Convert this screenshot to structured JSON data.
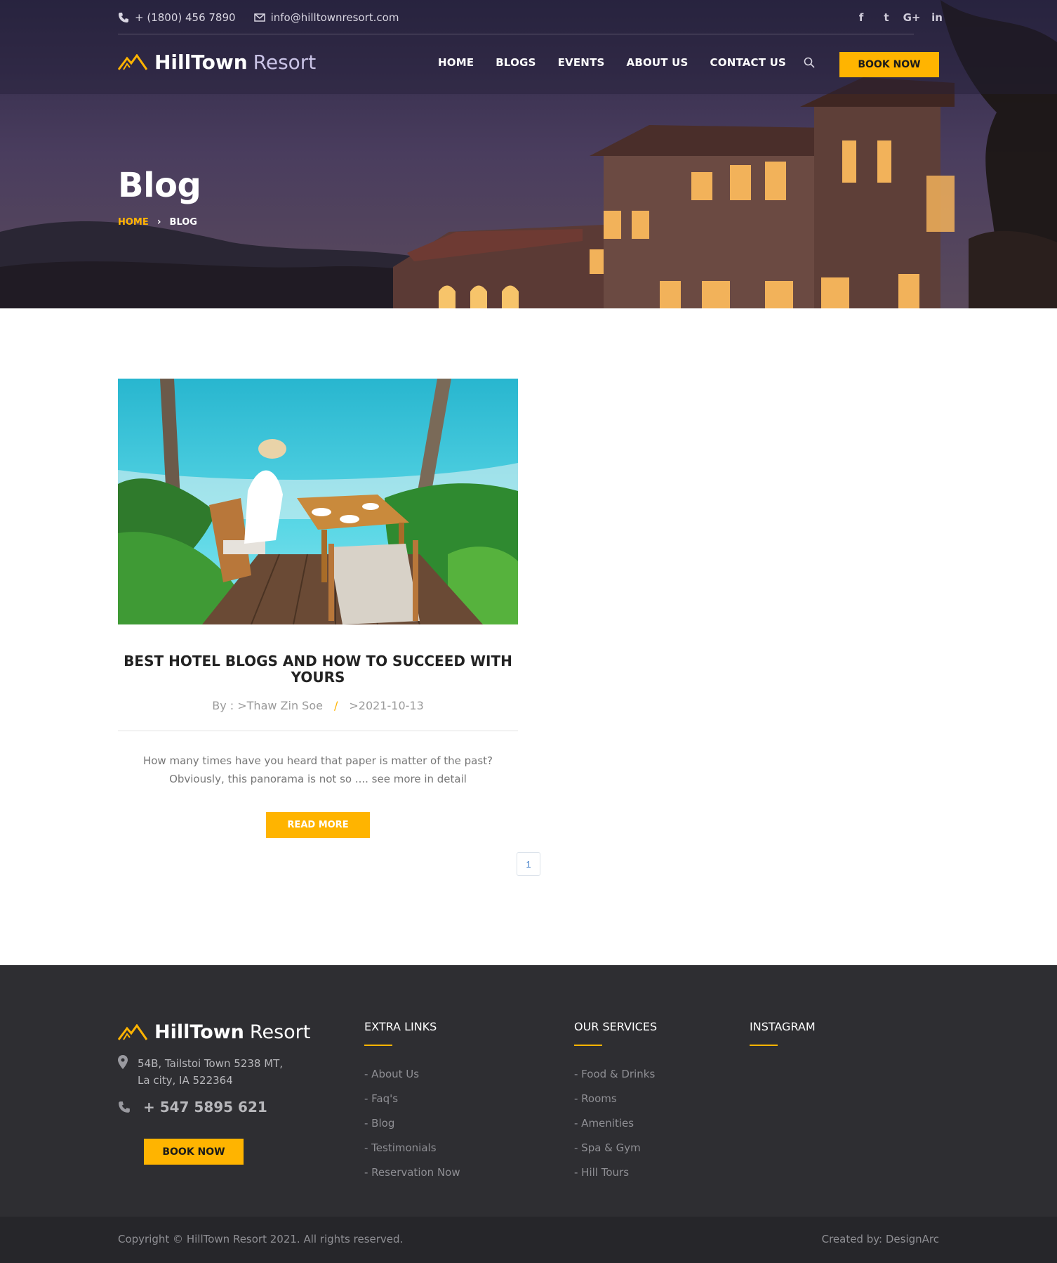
{
  "topbar": {
    "phone": "+ (1800) 456 7890",
    "email": "info@hilltownresort.com",
    "social": [
      "f",
      "t",
      "G+",
      "in"
    ]
  },
  "brand": {
    "name_bold": "HillTown",
    "name_light": "Resort"
  },
  "nav": {
    "items": [
      "HOME",
      "BLOGS",
      "EVENTS",
      "ABOUT US",
      "CONTACT US"
    ],
    "book_label": "BOOK NOW"
  },
  "hero": {
    "title": "Blog",
    "breadcrumb": {
      "home": "HOME",
      "separator": "›",
      "current": "BLOG"
    }
  },
  "post": {
    "title": "BEST HOTEL BLOGS AND HOW TO SUCCEED WITH YOURS",
    "author": "By : >Thaw Zin Soe",
    "separator": "/",
    "date": ">2021-10-13",
    "excerpt": "How many times have you heard that paper is matter of the past? Obviously, this panorama is not so .... see more in detail",
    "read_more": "READ MORE"
  },
  "pagination": {
    "current": "1"
  },
  "footer": {
    "address": [
      "54B, Tailstoi Town 5238 MT,",
      "La city, IA 522364"
    ],
    "phone": "+ 547 5895 621",
    "book_label": "BOOK NOW",
    "extra_links": {
      "title": "EXTRA LINKS",
      "items": [
        "- About Us",
        "- Faq's",
        "- Blog",
        "- Testimonials",
        "- Reservation Now"
      ]
    },
    "services": {
      "title": "OUR SERVICES",
      "items": [
        "- Food & Drinks",
        "- Rooms",
        "- Amenities",
        "- Spa & Gym",
        "- Hill Tours"
      ]
    },
    "instagram": {
      "title": "INSTAGRAM"
    },
    "copyright": "Copyright © HillTown Resort 2021. All rights reserved.",
    "created_by": "Created by: DesignArc"
  },
  "colors": {
    "accent": "#ffb400",
    "footer_bg": "#2e2e32",
    "footer_bottom_bg": "#26262a"
  },
  "icons": [
    "phone-icon",
    "mail-icon",
    "facebook-icon",
    "twitter-icon",
    "google-plus-icon",
    "linkedin-icon",
    "mountain-logo-icon",
    "search-icon",
    "map-pin-icon"
  ]
}
